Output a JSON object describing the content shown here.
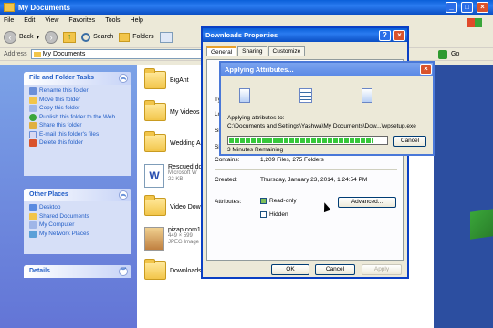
{
  "explorer": {
    "title": "My Documents",
    "menu": [
      "File",
      "Edit",
      "View",
      "Favorites",
      "Tools",
      "Help"
    ],
    "toolbar": {
      "back": "Back",
      "search": "Search",
      "folders": "Folders"
    },
    "address_label": "Address",
    "address_value": "My Documents",
    "go_label": "Go"
  },
  "tasks": {
    "file_folder": {
      "title": "File and Folder Tasks",
      "items": [
        "Rename this folder",
        "Move this folder",
        "Copy this folder",
        "Publish this folder to the Web",
        "Share this folder",
        "E-mail this folder's files",
        "Delete this folder"
      ]
    },
    "other_places": {
      "title": "Other Places",
      "items": [
        "Desktop",
        "Shared Documents",
        "My Computer",
        "My Network Places"
      ]
    },
    "details": {
      "title": "Details"
    }
  },
  "files": [
    {
      "name": "BigAnt",
      "sub": ""
    },
    {
      "name": "My Videos",
      "sub": ""
    },
    {
      "name": "Wedding Al",
      "sub": ""
    },
    {
      "name": "Rescued do",
      "sub": "Microsoft W\n22 KB"
    },
    {
      "name": "Video Dowi",
      "sub": ""
    },
    {
      "name": "pizap.com1",
      "sub": "449 × 599\nJPEG Image"
    },
    {
      "name": "Downloads",
      "sub": ""
    }
  ],
  "properties": {
    "title": "Downloads Properties",
    "tabs": [
      "General",
      "Sharing",
      "Customize"
    ],
    "contains_label": "Contains:",
    "contains_value": "1,209 Files, 275 Folders",
    "created_label": "Created:",
    "created_value": "Thursday, January 23, 2014, 1:24:54 PM",
    "attributes_label": "Attributes:",
    "readonly_label": "Read-only",
    "hidden_label": "Hidden",
    "advanced_label": "Advanced...",
    "ok_label": "OK",
    "cancel_label": "Cancel",
    "apply_label": "Apply",
    "hidden_letters": [
      "Ty",
      "Lo",
      "Si",
      "Si"
    ]
  },
  "applying": {
    "title": "Applying Attributes...",
    "line1": "Applying attributes to:",
    "path": "C:\\Documents and Settings\\Yashwa\\My Documents\\Dow...\\wpsetup.exe",
    "remaining": "3 Minutes Remaining",
    "cancel_label": "Cancel",
    "progress": 0.92
  }
}
